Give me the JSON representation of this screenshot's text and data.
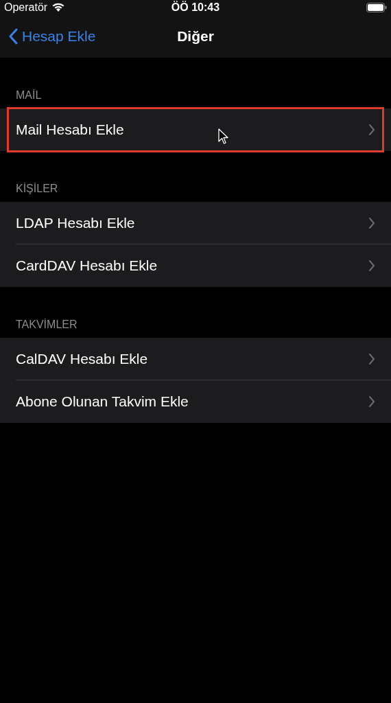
{
  "status_bar": {
    "carrier": "Operatör",
    "time": "ÖÖ 10:43"
  },
  "nav": {
    "back": "Hesap Ekle",
    "title": "Diğer"
  },
  "sections": [
    {
      "header": "MAİL",
      "items": [
        {
          "label": "Mail Hesabı Ekle",
          "highlighted": true,
          "cursor": true
        }
      ]
    },
    {
      "header": "KİŞİLER",
      "items": [
        {
          "label": "LDAP Hesabı Ekle",
          "highlighted": false,
          "cursor": false
        },
        {
          "label": "CardDAV Hesabı Ekle",
          "highlighted": false,
          "cursor": false
        }
      ]
    },
    {
      "header": "TAKVİMLER",
      "items": [
        {
          "label": "CalDAV Hesabı Ekle",
          "highlighted": false,
          "cursor": false
        },
        {
          "label": "Abone Olunan Takvim Ekle",
          "highlighted": false,
          "cursor": false
        }
      ]
    }
  ]
}
